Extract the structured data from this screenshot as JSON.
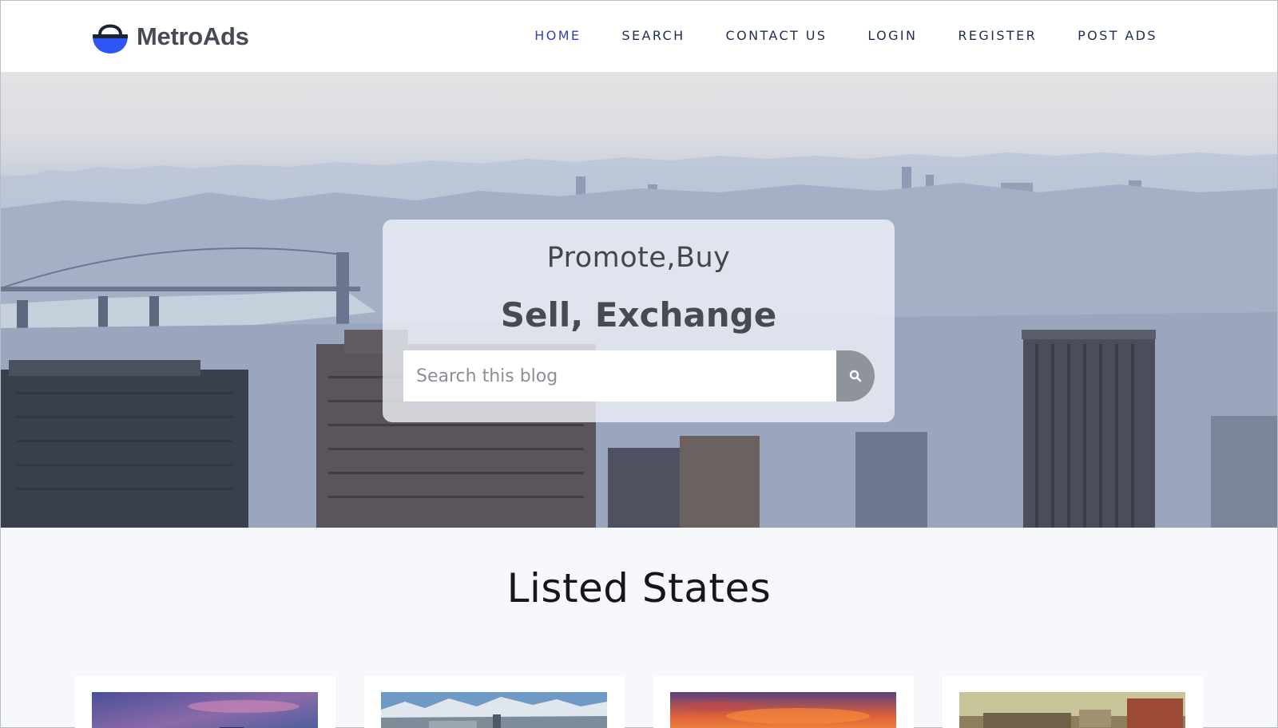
{
  "brand": {
    "name": "MetroAds",
    "icon": "shopping-basket-icon",
    "color": "#2f55f4"
  },
  "nav": {
    "items": [
      {
        "label": "HOME",
        "active": true
      },
      {
        "label": "SEARCH",
        "active": false
      },
      {
        "label": "CONTACT US",
        "active": false
      },
      {
        "label": "LOGIN",
        "active": false
      },
      {
        "label": "REGISTER",
        "active": false
      },
      {
        "label": "POST ADS",
        "active": false
      }
    ],
    "active_color": "#3043b9",
    "color": "#1f2d52"
  },
  "hero": {
    "subtitle": "Promote,Buy",
    "title": "Sell, Exchange",
    "search": {
      "placeholder": "Search this blog",
      "value": "",
      "button_icon": "search-icon"
    },
    "background": "city-skyline"
  },
  "listed_states": {
    "title": "Listed States",
    "cards": [
      {
        "image": "purple-dusk-city-skyline"
      },
      {
        "image": "snowy-mountain-city-panorama"
      },
      {
        "image": "orange-sunset-sky"
      },
      {
        "image": "vintage-town-street"
      }
    ]
  }
}
